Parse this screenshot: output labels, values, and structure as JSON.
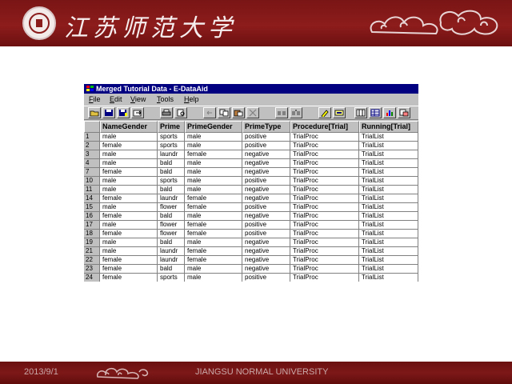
{
  "slide": {
    "header_title": "江苏师范大学",
    "footer_date": "2013/9/1",
    "footer_university": "JIANGSU NORMAL UNIVERSITY",
    "colors": {
      "banner": "#7a1515",
      "footer": "#6a0f0f",
      "titlebar": "#000080"
    }
  },
  "window": {
    "title": "Merged Tutorial Data - E-DataAid",
    "menu": [
      {
        "label": "File",
        "underline": "F",
        "rest": "ile"
      },
      {
        "label": "Edit",
        "underline": "E",
        "rest": "dit"
      },
      {
        "label": "View",
        "underline": "V",
        "rest": "iew"
      },
      {
        "label": "Tools",
        "underline": "T",
        "rest": "ools"
      },
      {
        "label": "Help",
        "underline": "H",
        "rest": "elp"
      }
    ],
    "toolbar_icons": [
      "open-icon",
      "save-icon",
      "save-as-icon",
      "export-icon",
      "print-icon",
      "print-preview-icon",
      "undo-icon",
      "copy-icon",
      "paste-icon",
      "delete-icon",
      "find-icon",
      "replace-icon",
      "edit-icon",
      "filter-icon",
      "arrange-columns-icon",
      "table-icon",
      "analyze-icon",
      "properties-icon"
    ]
  },
  "table": {
    "columns": [
      "NameGender",
      "Prime",
      "PrimeGender",
      "PrimeType",
      "Procedure[Trial]",
      "Running[Trial]"
    ],
    "rows": [
      [
        "1",
        "male",
        "sports",
        "male",
        "positive",
        "TrialProc",
        "TrialList"
      ],
      [
        "2",
        "female",
        "sports",
        "male",
        "positive",
        "TrialProc",
        "TrialList"
      ],
      [
        "3",
        "male",
        "laundr",
        "female",
        "negative",
        "TrialProc",
        "TrialList"
      ],
      [
        "4",
        "male",
        "bald",
        "male",
        "negative",
        "TrialProc",
        "TrialList"
      ],
      [
        "7",
        "female",
        "bald",
        "male",
        "negative",
        "TrialProc",
        "TrialList"
      ],
      [
        "10",
        "male",
        "sports",
        "male",
        "positive",
        "TrialProc",
        "TrialList"
      ],
      [
        "11",
        "male",
        "bald",
        "male",
        "negative",
        "TrialProc",
        "TrialList"
      ],
      [
        "14",
        "female",
        "laundr",
        "female",
        "negative",
        "TrialProc",
        "TrialList"
      ],
      [
        "15",
        "male",
        "flower",
        "female",
        "positive",
        "TrialProc",
        "TrialList"
      ],
      [
        "16",
        "female",
        "bald",
        "male",
        "negative",
        "TrialProc",
        "TrialList"
      ],
      [
        "17",
        "male",
        "flower",
        "female",
        "positive",
        "TrialProc",
        "TrialList"
      ],
      [
        "18",
        "female",
        "flower",
        "female",
        "positive",
        "TrialProc",
        "TrialList"
      ],
      [
        "19",
        "male",
        "bald",
        "male",
        "negative",
        "TrialProc",
        "TrialList"
      ],
      [
        "21",
        "male",
        "laundr",
        "female",
        "negative",
        "TrialProc",
        "TrialList"
      ],
      [
        "22",
        "female",
        "laundr",
        "female",
        "negative",
        "TrialProc",
        "TrialList"
      ],
      [
        "23",
        "female",
        "bald",
        "male",
        "negative",
        "TrialProc",
        "TrialList"
      ],
      [
        "24",
        "female",
        "sports",
        "male",
        "positive",
        "TrialProc",
        "TrialList"
      ]
    ]
  }
}
